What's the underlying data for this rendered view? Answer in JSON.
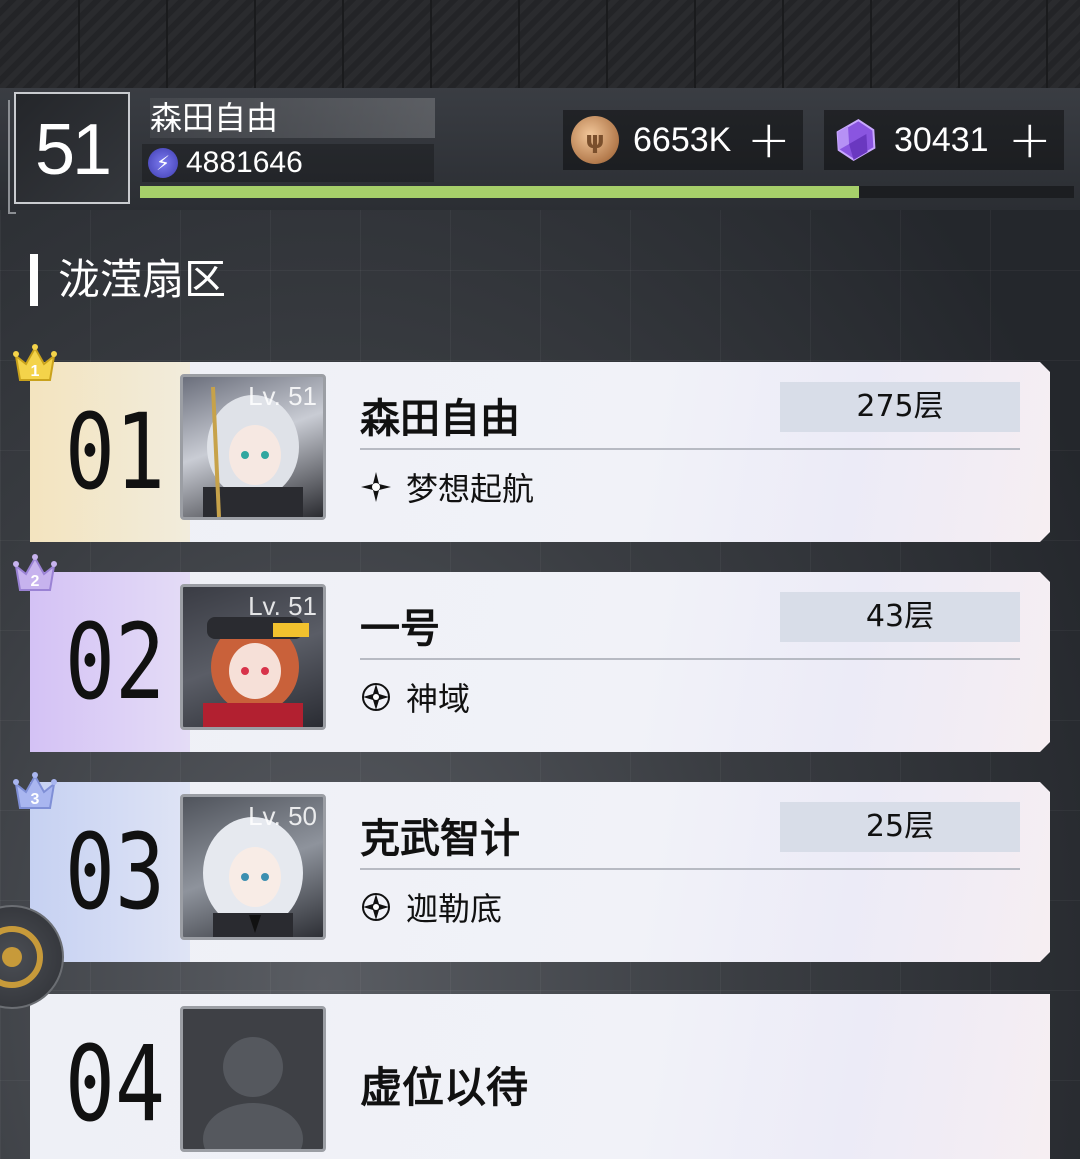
{
  "player": {
    "level": "51",
    "name": "森田自由",
    "power": "4881646",
    "exp_fraction": 0.77
  },
  "resources": [
    {
      "icon": "coin-icon",
      "value": "6653K",
      "plus": "+"
    },
    {
      "icon": "crystal-icon",
      "value": "30431",
      "plus": "+"
    }
  ],
  "section": {
    "title": "泷滢扇区"
  },
  "ranks": [
    {
      "rank": "01",
      "crown": "1",
      "level": "Lv. 51",
      "name": "森田自由",
      "floor": "275层",
      "guild": "梦想起航"
    },
    {
      "rank": "02",
      "crown": "2",
      "level": "Lv. 51",
      "name": "一号",
      "floor": "43层",
      "guild": "神域"
    },
    {
      "rank": "03",
      "crown": "3",
      "level": "Lv. 50",
      "name": "克武智计",
      "floor": "25层",
      "guild": "迦勒底"
    },
    {
      "rank": "04",
      "vacant_text": "虚位以待"
    }
  ],
  "colors": {
    "exp_bar": "#a6cf6a",
    "rank1_tint": "#f3e4bf",
    "rank2_tint": "#d4c2f5",
    "rank3_tint": "#c6d1f2"
  }
}
